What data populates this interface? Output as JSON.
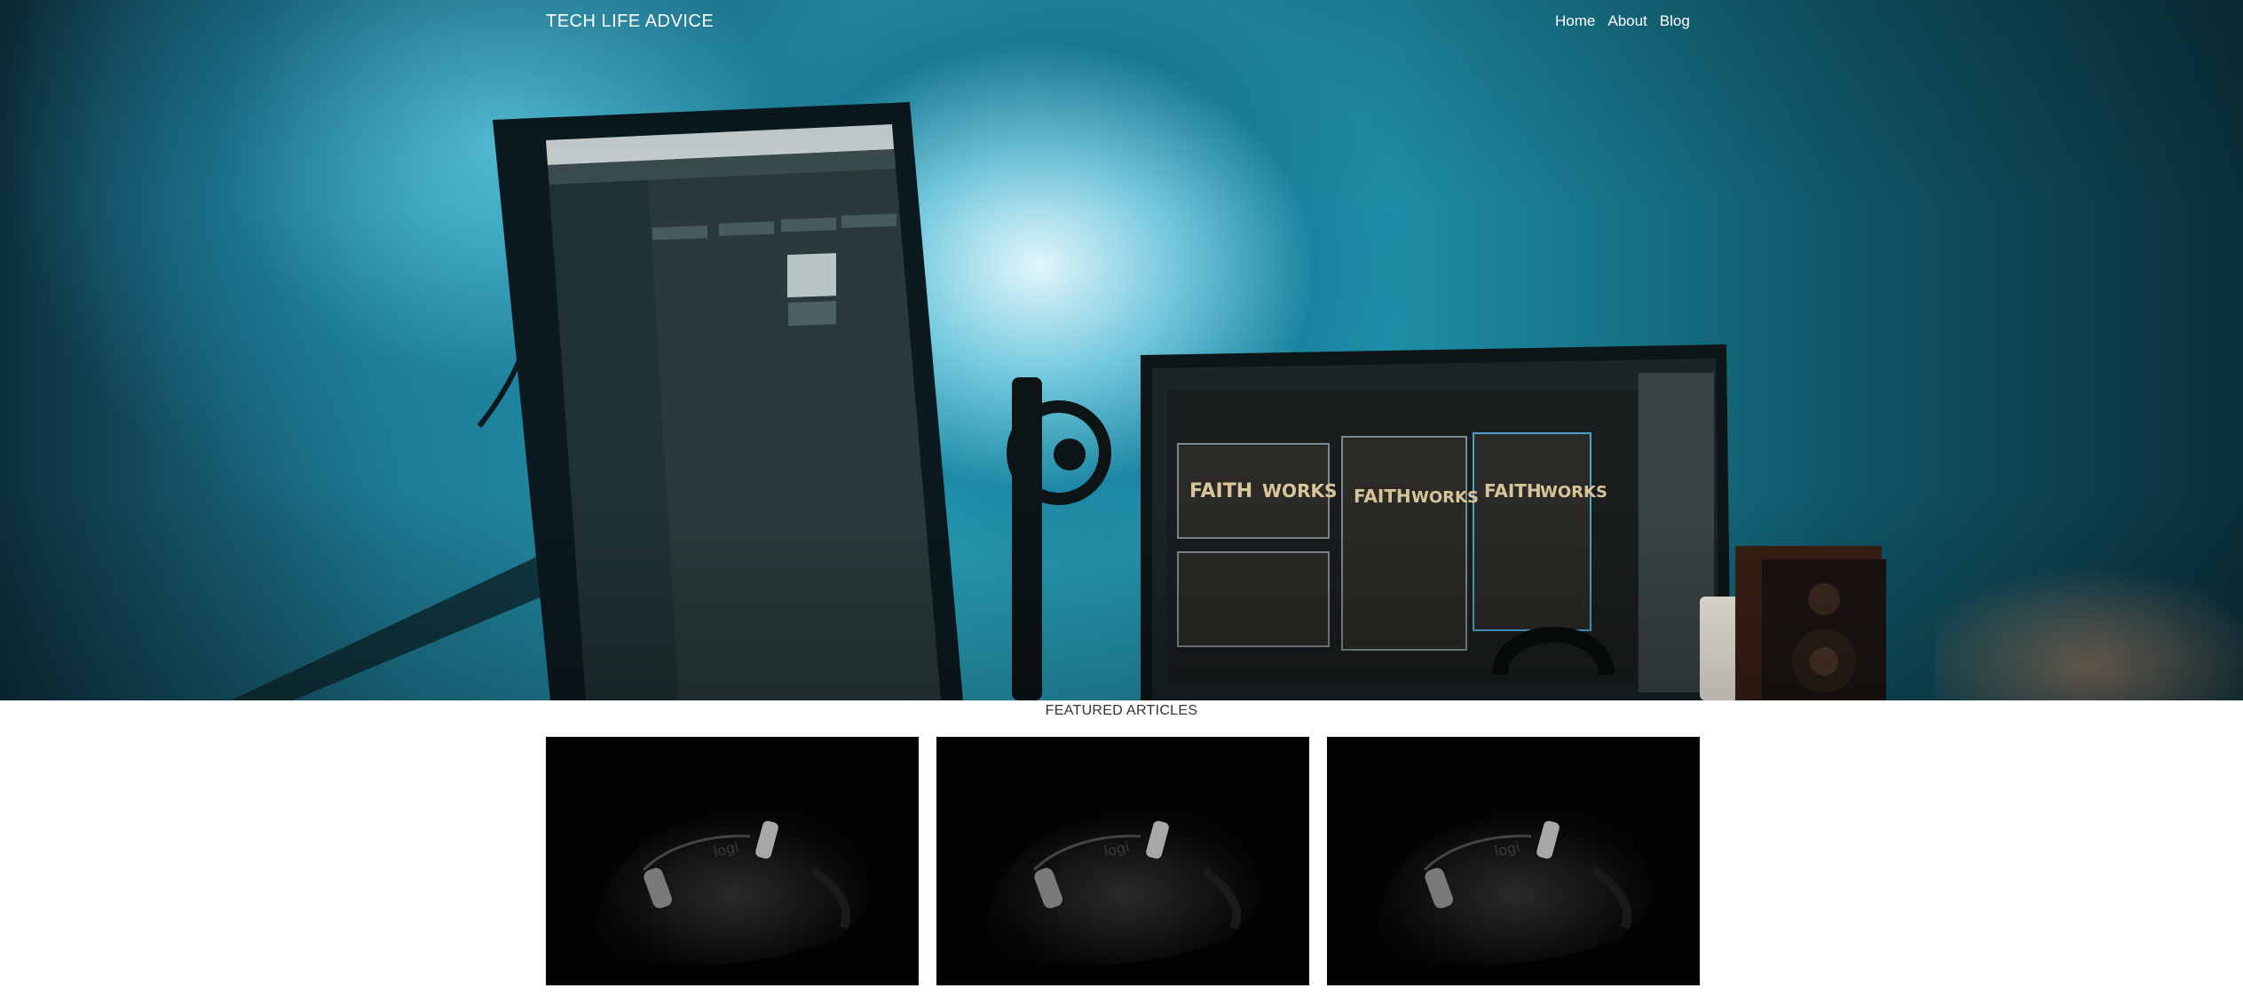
{
  "header": {
    "site_title": "TECH LIFE ADVICE",
    "nav": [
      {
        "label": "Home"
      },
      {
        "label": "About"
      },
      {
        "label": "Blog"
      }
    ]
  },
  "hero": {
    "image": "desk-setup-monitors-photo",
    "poster_text": [
      "FAITH",
      "WORKS"
    ]
  },
  "featured": {
    "heading": "FEATURED ARTICLES",
    "articles": [
      {
        "image": "computer-mouse-photo",
        "mouse_brand": "logi"
      },
      {
        "image": "computer-mouse-photo",
        "mouse_brand": "logi"
      },
      {
        "image": "computer-mouse-photo",
        "mouse_brand": "logi"
      }
    ]
  },
  "colors": {
    "hero_teal": "#2aa4bd",
    "nav_text": "#ffffff",
    "heading_text": "#333333",
    "card_bg": "#030303"
  }
}
